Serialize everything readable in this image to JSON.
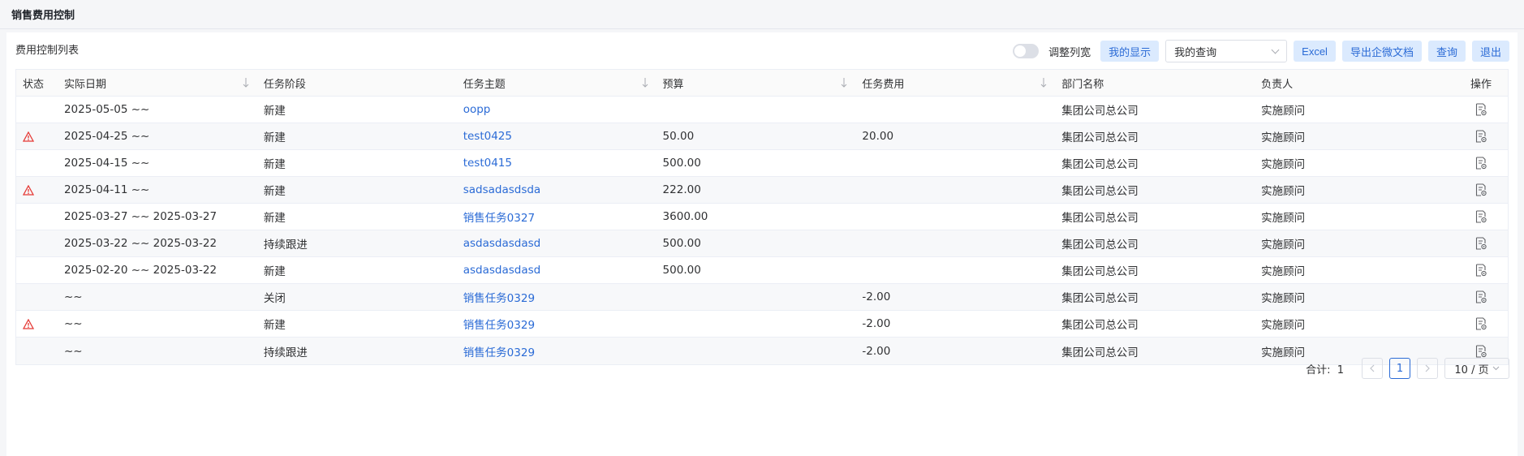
{
  "page": {
    "title": "销售费用控制"
  },
  "toolbar": {
    "list_title": "费用控制列表",
    "toggle_label": "调整列宽",
    "my_display": "我的显示",
    "my_query_select": "我的查询",
    "excel": "Excel",
    "export_wecom": "导出企微文档",
    "query": "查询",
    "exit": "退出"
  },
  "table": {
    "headers": {
      "status": "状态",
      "date": "实际日期",
      "stage": "任务阶段",
      "topic": "任务主题",
      "budget": "预算",
      "cost": "任务费用",
      "dept": "部门名称",
      "owner": "负责人",
      "op": "操作"
    },
    "rows": [
      {
        "warn": false,
        "date": "2025-05-05 ~~",
        "stage": "新建",
        "topic": "oopp",
        "budget": "",
        "cost": "",
        "dept": "集团公司总公司",
        "owner": "实施顾问"
      },
      {
        "warn": true,
        "date": "2025-04-25 ~~",
        "stage": "新建",
        "topic": "test0425",
        "budget": "50.00",
        "cost": "20.00",
        "dept": "集团公司总公司",
        "owner": "实施顾问"
      },
      {
        "warn": false,
        "date": "2025-04-15 ~~",
        "stage": "新建",
        "topic": "test0415",
        "budget": "500.00",
        "cost": "",
        "dept": "集团公司总公司",
        "owner": "实施顾问"
      },
      {
        "warn": true,
        "date": "2025-04-11 ~~",
        "stage": "新建",
        "topic": "sadsadasdsda",
        "budget": "222.00",
        "cost": "",
        "dept": "集团公司总公司",
        "owner": "实施顾问"
      },
      {
        "warn": false,
        "date": "2025-03-27 ~~ 2025-03-27",
        "stage": "新建",
        "topic": "销售任务0327",
        "budget": "3600.00",
        "cost": "",
        "dept": "集团公司总公司",
        "owner": "实施顾问"
      },
      {
        "warn": false,
        "date": "2025-03-22 ~~ 2025-03-22",
        "stage": "持续跟进",
        "topic": "asdasdasdasd",
        "budget": "500.00",
        "cost": "",
        "dept": "集团公司总公司",
        "owner": "实施顾问"
      },
      {
        "warn": false,
        "date": "2025-02-20 ~~ 2025-03-22",
        "stage": "新建",
        "topic": "asdasdasdasd",
        "budget": "500.00",
        "cost": "",
        "dept": "集团公司总公司",
        "owner": "实施顾问"
      },
      {
        "warn": false,
        "date": "~~",
        "stage": "关闭",
        "topic": "销售任务0329",
        "budget": "",
        "cost": "-2.00",
        "dept": "集团公司总公司",
        "owner": "实施顾问"
      },
      {
        "warn": true,
        "date": "~~",
        "stage": "新建",
        "topic": "销售任务0329",
        "budget": "",
        "cost": "-2.00",
        "dept": "集团公司总公司",
        "owner": "实施顾问"
      },
      {
        "warn": false,
        "date": "~~",
        "stage": "持续跟进",
        "topic": "销售任务0329",
        "budget": "",
        "cost": "-2.00",
        "dept": "集团公司总公司",
        "owner": "实施顾问"
      }
    ]
  },
  "pager": {
    "total_label": "合计:",
    "total": "1",
    "current_page": "1",
    "page_size": "10 / 页"
  },
  "colors": {
    "accent": "#2b6bd6",
    "warn": "#e53935",
    "button_bg": "#dbeafe"
  },
  "icons": {
    "warn": "warning-triangle-icon",
    "op": "document-view-icon",
    "sort": "sort-down-icon"
  }
}
